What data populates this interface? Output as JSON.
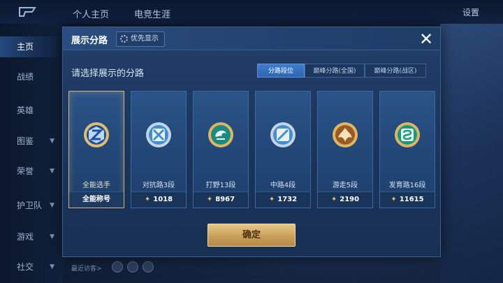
{
  "topbar": {
    "tabs": [
      "个人主页",
      "电竞生涯"
    ],
    "settings_label": "设置"
  },
  "sidebar": {
    "items": [
      {
        "label": "主页",
        "active": true,
        "arrow": false
      },
      {
        "label": "战绩",
        "active": false,
        "arrow": false
      },
      {
        "label": "英雄",
        "active": false,
        "arrow": false
      },
      {
        "label": "图鉴",
        "active": false,
        "arrow": true
      },
      {
        "label": "荣誉",
        "active": false,
        "arrow": true
      },
      {
        "label": "护卫队",
        "active": false,
        "arrow": true
      },
      {
        "label": "游戏",
        "active": false,
        "arrow": true
      },
      {
        "label": "社交",
        "active": false,
        "arrow": true
      }
    ]
  },
  "bottom": {
    "recent_visitors_label": "最近访客>"
  },
  "modal": {
    "title": "展示分路",
    "priority_label": "优先显示",
    "prompt": "请选择展示的分路",
    "segments": [
      {
        "label": "分路段位",
        "active": true
      },
      {
        "label": "巅峰分路(全国)",
        "active": false
      },
      {
        "label": "巅峰分路(战区)",
        "active": false
      }
    ],
    "cards": [
      {
        "name": "全能选手",
        "foot": "全能称号",
        "score": null,
        "selected": true,
        "icon": "all-round-badge-icon"
      },
      {
        "name": "对抗路3段",
        "foot": null,
        "score": "1018",
        "selected": false,
        "icon": "clash-lane-badge-icon"
      },
      {
        "name": "打野13段",
        "foot": null,
        "score": "8967",
        "selected": false,
        "icon": "jungle-badge-icon"
      },
      {
        "name": "中路4段",
        "foot": null,
        "score": "1732",
        "selected": false,
        "icon": "mid-lane-badge-icon"
      },
      {
        "name": "游走5段",
        "foot": null,
        "score": "2190",
        "selected": false,
        "icon": "roam-badge-icon"
      },
      {
        "name": "发育路16段",
        "foot": null,
        "score": "11615",
        "selected": false,
        "icon": "farm-lane-badge-icon"
      }
    ],
    "confirm_label": "确定"
  },
  "colors": {
    "accent_gold": "#d7b577",
    "segment_active": "#3f7ed0",
    "panel": "#1a3459"
  }
}
